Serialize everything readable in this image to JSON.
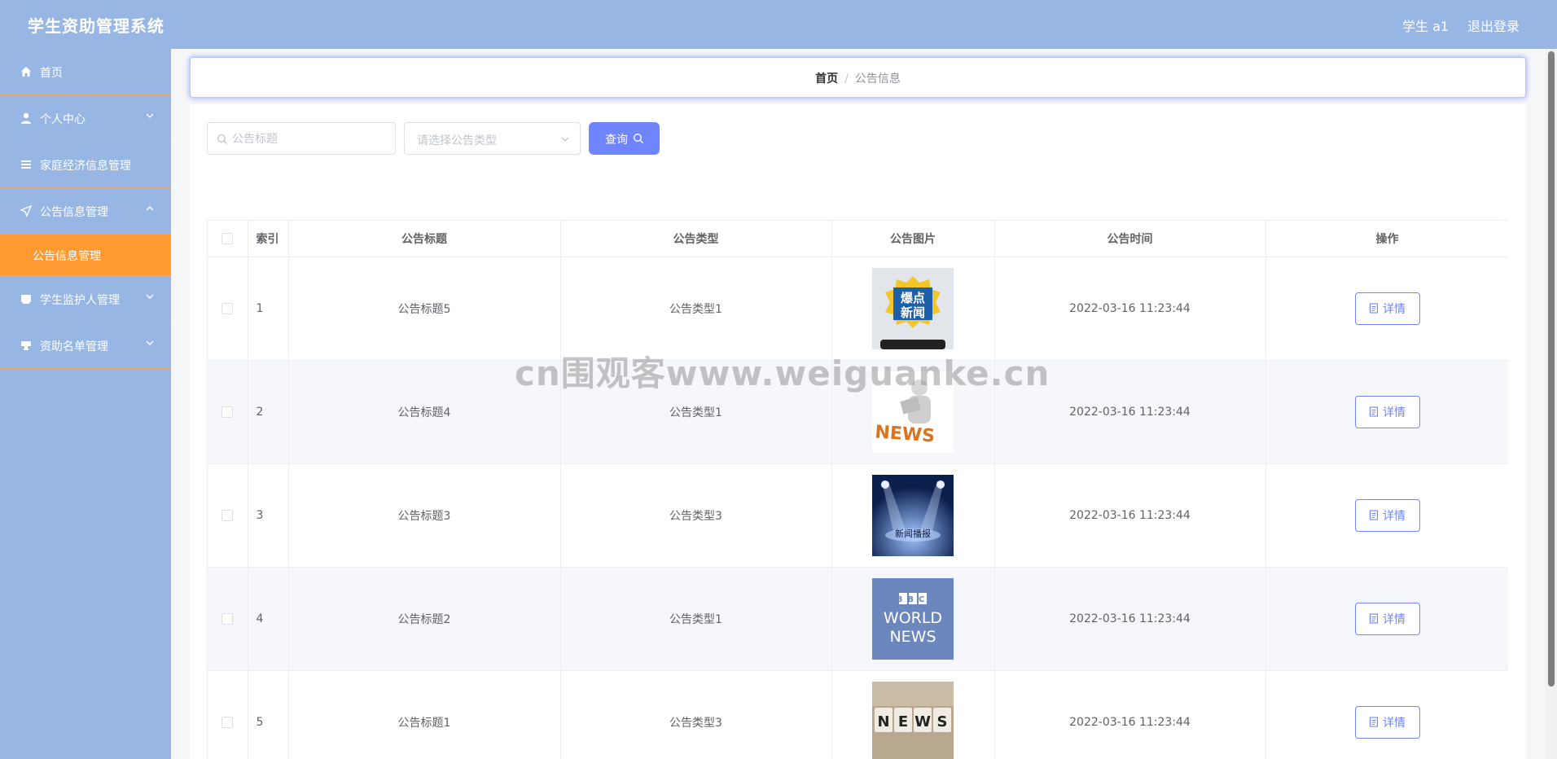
{
  "header": {
    "title": "学生资助管理系统",
    "user": "学生 a1",
    "logout": "退出登录"
  },
  "sidebar": {
    "items": [
      {
        "label": "首页",
        "icon": "home-icon"
      },
      {
        "label": "个人中心",
        "icon": "user-icon"
      },
      {
        "label": "家庭经济信息管理",
        "icon": "list-icon"
      },
      {
        "label": "公告信息管理",
        "icon": "send-icon"
      },
      {
        "label": "学生监护人管理",
        "icon": "folder-icon"
      },
      {
        "label": "资助名单管理",
        "icon": "stamp-icon"
      }
    ],
    "active_sub": "公告信息管理"
  },
  "breadcrumb": {
    "home": "首页",
    "separator": "/",
    "current": "公告信息"
  },
  "filters": {
    "title_placeholder": "公告标题",
    "type_placeholder": "请选择公告类型",
    "query_label": "查询"
  },
  "table": {
    "headers": {
      "index": "索引",
      "title": "公告标题",
      "type": "公告类型",
      "image": "公告图片",
      "time": "公告时间",
      "actions": "操作"
    },
    "detail_label": "详情",
    "rows": [
      {
        "index": "1",
        "title": "公告标题5",
        "type": "公告类型1",
        "time": "2022-03-16 11:23:44",
        "image": "baodian-news"
      },
      {
        "index": "2",
        "title": "公告标题4",
        "type": "公告类型1",
        "time": "2022-03-16 11:23:44",
        "image": "figure-news"
      },
      {
        "index": "3",
        "title": "公告标题3",
        "type": "公告类型3",
        "time": "2022-03-16 11:23:44",
        "image": "stage-news"
      },
      {
        "index": "4",
        "title": "公告标题2",
        "type": "公告类型1",
        "time": "2022-03-16 11:23:44",
        "image": "bbc-world-news"
      },
      {
        "index": "5",
        "title": "公告标题1",
        "type": "公告类型3",
        "time": "2022-03-16 11:23:44",
        "image": "news-blocks"
      }
    ]
  },
  "thumbnails": {
    "baodian": {
      "line1": "爆点",
      "line2": "新闻"
    },
    "figure": {
      "word": "NEWS"
    },
    "stage": {
      "caption": "新闻播报"
    },
    "bbc": {
      "logo": "BBC",
      "line1": "WORLD",
      "line2": "NEWS"
    },
    "blocks": {
      "letters": [
        "N",
        "E",
        "W",
        "S"
      ]
    }
  },
  "watermark": "cn围观客www.weiguanke.cn",
  "colors": {
    "header_bg": "#97b6e4",
    "sidebar_bg": "#97b6e4",
    "active_sub_bg": "#ff9a33",
    "primary": "#6f85ff",
    "divider": "#f2a86a"
  }
}
